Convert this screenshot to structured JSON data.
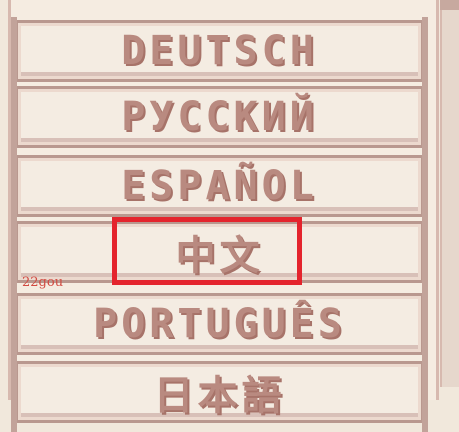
{
  "languages": [
    "DEUTSCH",
    "РУССКИЙ",
    "ESPAÑOL",
    "中文",
    "PORTUGUÊS",
    "日本語"
  ],
  "selected_language": "中文",
  "watermark": "22gou",
  "colors": {
    "selection_border": "#e4242d",
    "text": "#b98a80"
  }
}
